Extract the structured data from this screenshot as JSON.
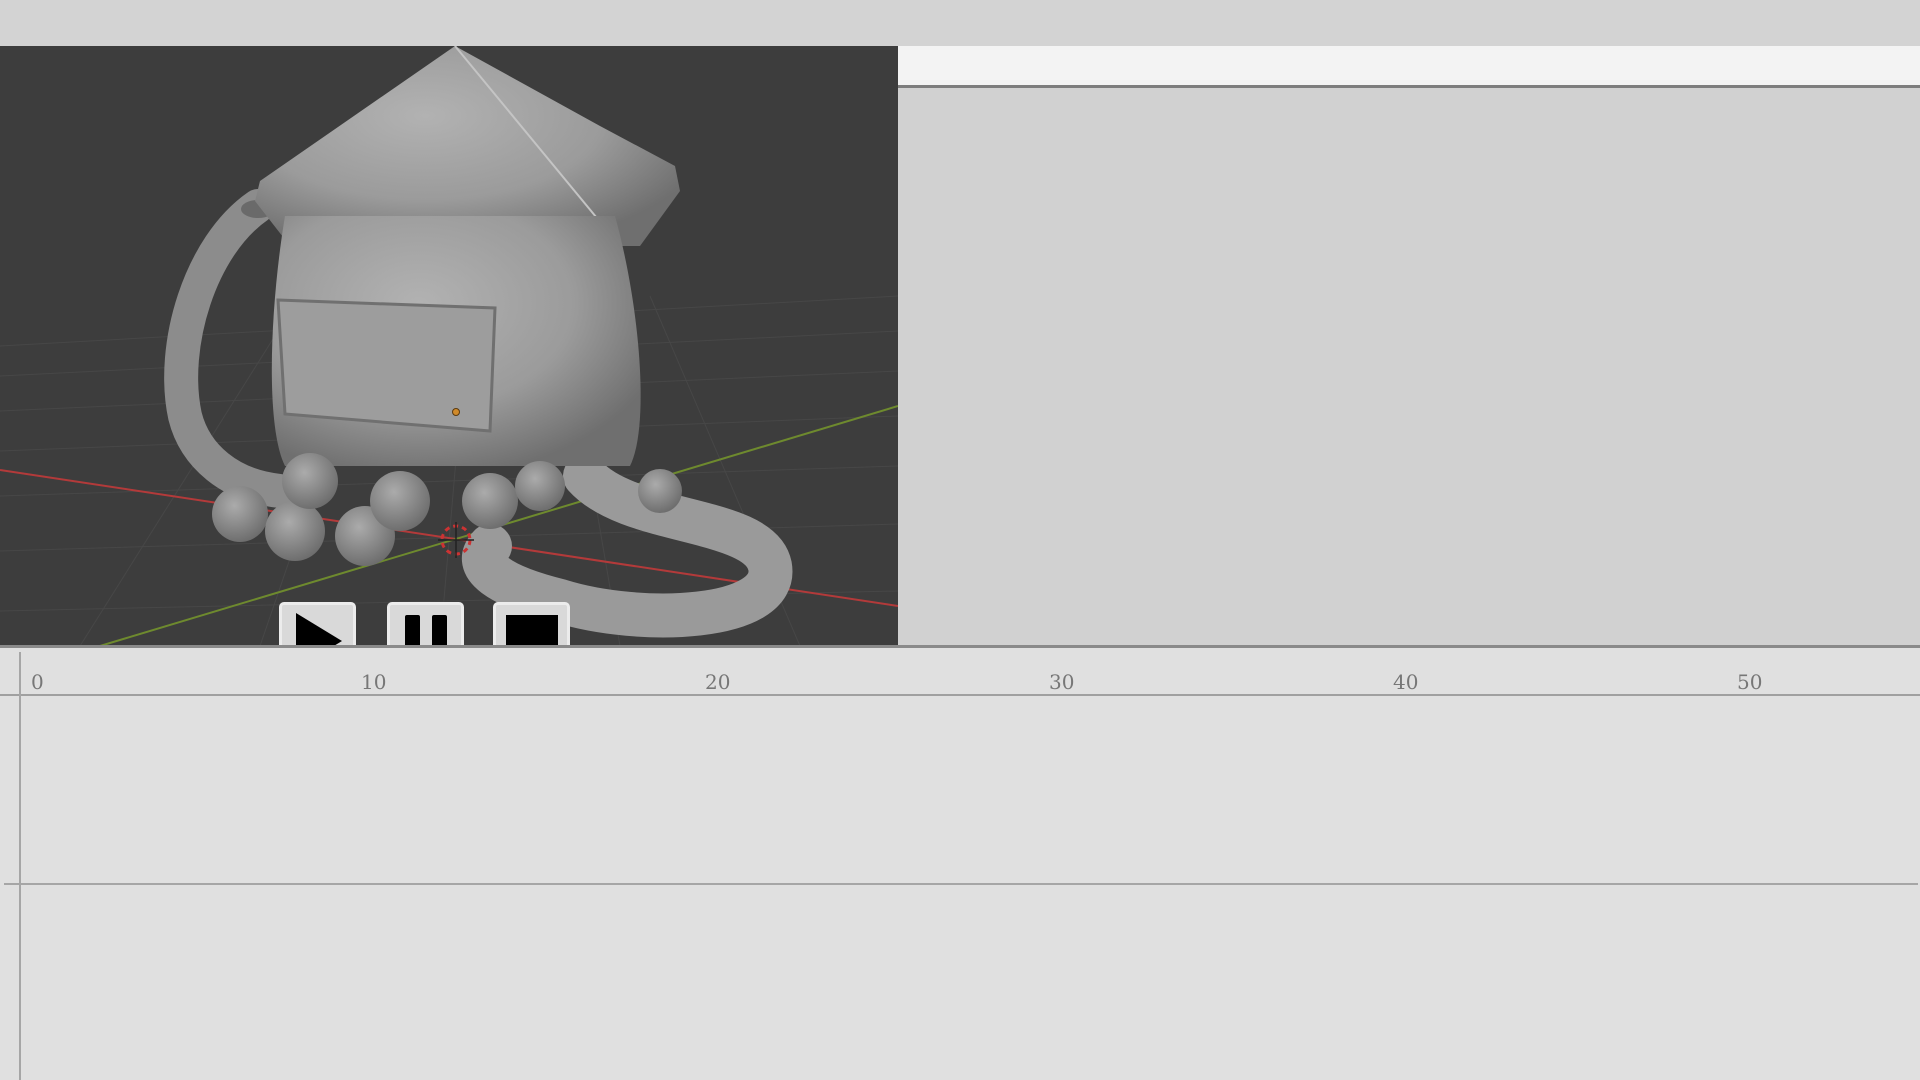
{
  "timeline": {
    "ticks": [
      "0",
      "10",
      "20",
      "30",
      "40",
      "50"
    ]
  },
  "controls": {
    "play": "play-icon",
    "pause": "pause-icon",
    "stop": "stop-icon"
  },
  "colors": {
    "viewport_bg": "#3d3d3d",
    "panel_bg": "#d1d1d1",
    "timeline_bg": "#e0e0e0",
    "x_axis": "#b33a3a",
    "y_axis": "#6e8a2e"
  }
}
